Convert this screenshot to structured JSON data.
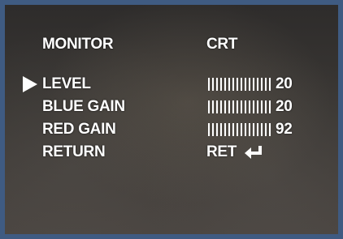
{
  "header": {
    "title_left": "MONITOR",
    "title_right": "CRT"
  },
  "menu": {
    "items": [
      {
        "label": "LEVEL",
        "selected": true
      },
      {
        "label": "BLUE GAIN",
        "selected": false
      },
      {
        "label": "RED GAIN",
        "selected": false
      },
      {
        "label": "RETURN",
        "selected": false
      }
    ]
  },
  "settings": [
    {
      "name": "LEVEL",
      "value": "20"
    },
    {
      "name": "BLUE GAIN",
      "value": "20"
    },
    {
      "name": "RED GAIN",
      "value": "92"
    }
  ],
  "return_target": {
    "label": "RET",
    "icon": "enter-icon"
  },
  "cursor_icon": "right-triangle-icon",
  "colors": {
    "frame": "#3f5b82",
    "osd_text": "#ffffff"
  }
}
